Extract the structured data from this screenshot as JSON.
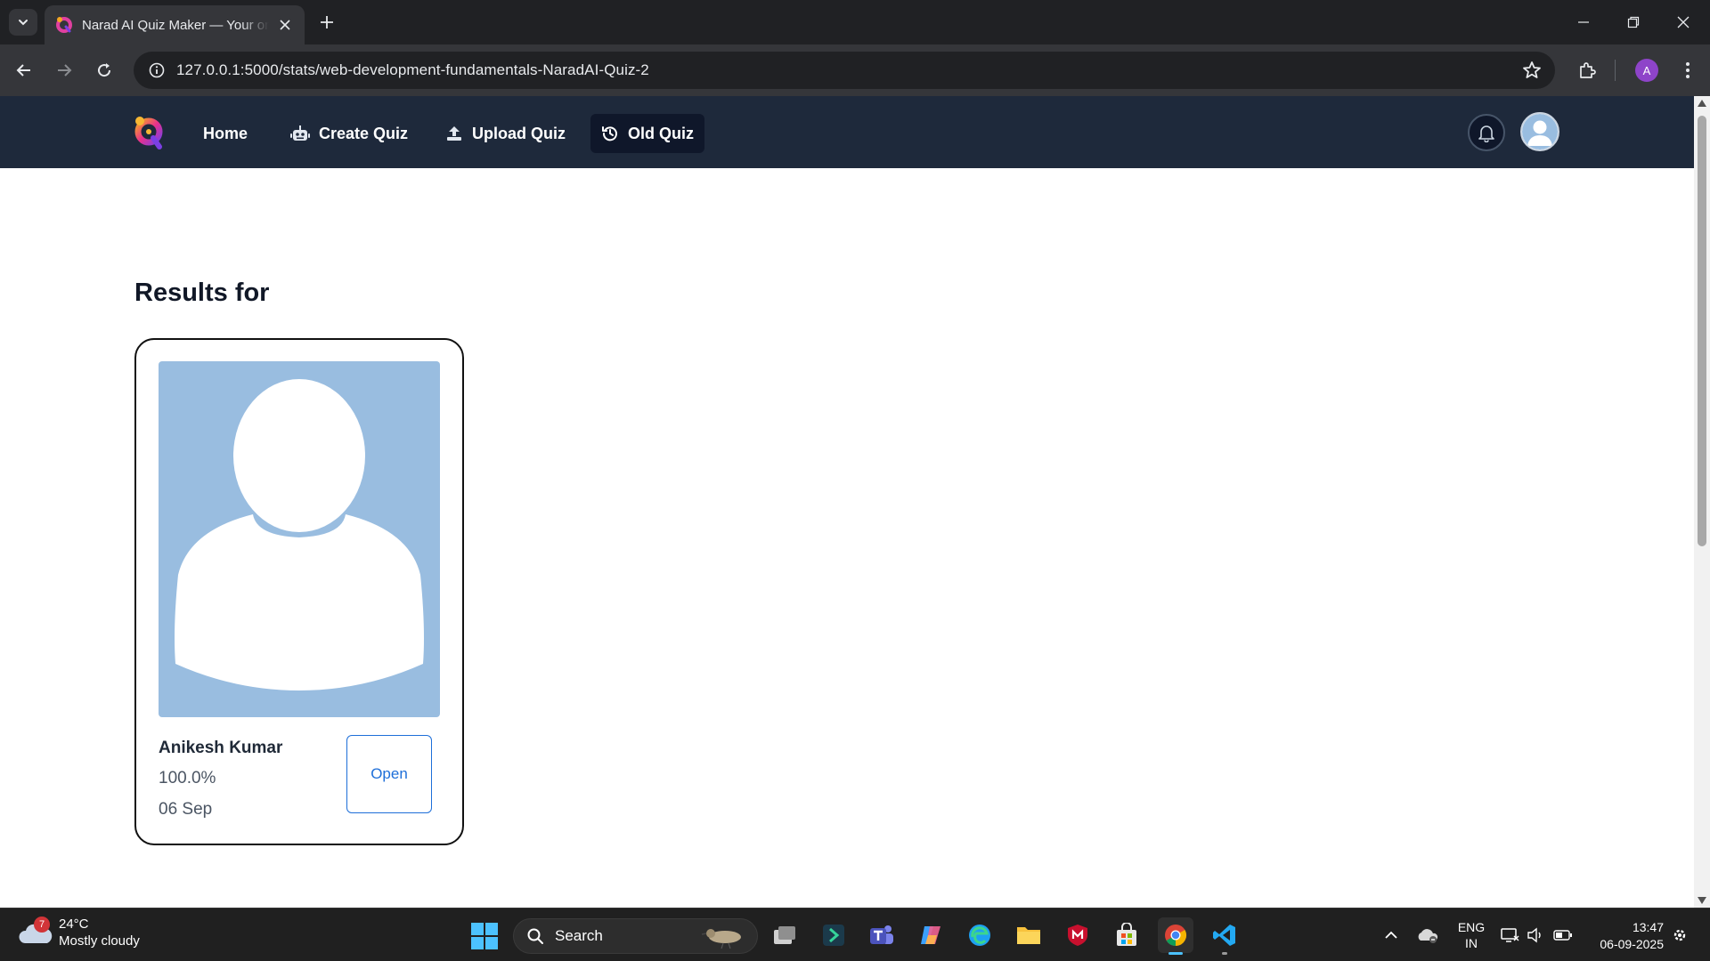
{
  "browser": {
    "tab_title": "Narad AI Quiz Maker — Your one-stop AI quiz tool",
    "url": "127.0.0.1:5000/stats/web-development-fundamentals-NaradAI-Quiz-2",
    "profile_initial": "A"
  },
  "nav": {
    "home": "Home",
    "create_quiz": "Create Quiz",
    "upload_quiz": "Upload Quiz",
    "old_quiz": "Old Quiz",
    "active": "Old Quiz"
  },
  "main": {
    "heading": "Results for",
    "results": [
      {
        "name": "Anikesh Kumar",
        "score": "100.0%",
        "date": "06 Sep",
        "open_label": "Open"
      }
    ]
  },
  "taskbar": {
    "weather_badge": "7",
    "temperature": "24°C",
    "condition": "Mostly cloudy",
    "search_label": "Search",
    "lang_line1": "ENG",
    "lang_line2": "IN",
    "time": "13:47",
    "date": "06-09-2025"
  },
  "colors": {
    "app_nav_bg": "#1e293b",
    "active_nav_bg": "#0f172a",
    "avatar_bg": "#99bde0",
    "open_button": "#1e6fd9"
  }
}
